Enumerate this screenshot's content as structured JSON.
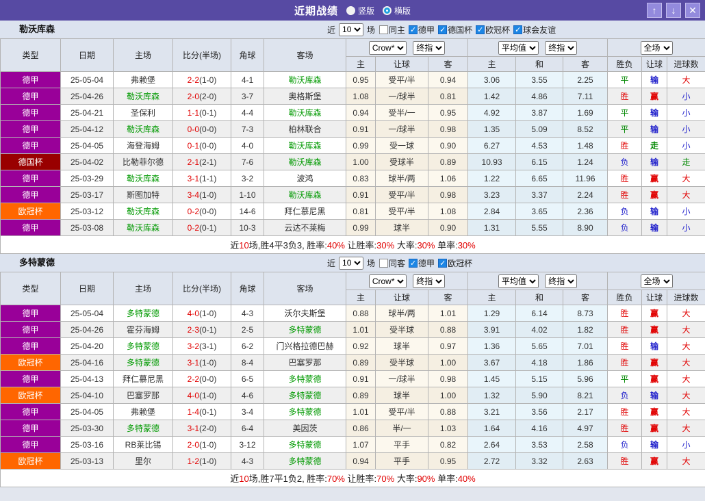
{
  "header": {
    "title": "近期战绩",
    "view_options": [
      {
        "label": "竖版",
        "selected": false
      },
      {
        "label": "横版",
        "selected": true
      }
    ],
    "buttons": {
      "up": "↑",
      "down": "↓",
      "close": "✕"
    }
  },
  "filters_labels": {
    "near": "近",
    "games": "场"
  },
  "selects": {
    "book": "Crow*",
    "final": "终指",
    "avg": "平均值",
    "scope": "全场"
  },
  "columns": {
    "type": "类型",
    "date": "日期",
    "home": "主场",
    "score": "比分(半场)",
    "corner": "角球",
    "away": "客场",
    "sub_home": "主",
    "sub_handicap": "让球",
    "sub_away": "客",
    "sub_avg_home": "主",
    "sub_avg_draw": "和",
    "sub_avg_away": "客",
    "sub_wdl": "胜负",
    "sub_handicap_result": "让球",
    "sub_goals": "进球数"
  },
  "colors": {
    "titlebar": "#574aa3",
    "badge": {
      "德甲": "#990099",
      "德国杯": "#990000",
      "欧冠杯": "#ff6600"
    },
    "result": {
      "胜": "#e10000",
      "平": "#008800",
      "负": "#2222cc",
      "赢": "#e10000",
      "输": "#2222cc",
      "走": "#008800",
      "大": "#e10000",
      "小": "#2222cc"
    },
    "focal_team": "#009900"
  },
  "tables": [
    {
      "team": "勒沃库森",
      "filters": {
        "count": "10",
        "checkboxes": [
          {
            "label": "同主",
            "checked": false
          },
          {
            "label": "德甲",
            "checked": true
          },
          {
            "label": "德国杯",
            "checked": true
          },
          {
            "label": "欧冠杯",
            "checked": true
          },
          {
            "label": "球会友谊",
            "checked": true
          }
        ]
      },
      "rows": [
        {
          "type": "德甲",
          "date": "25-05-04",
          "home": "弗赖堡",
          "score": "2-2",
          "half": "(1-0)",
          "corner": "4-1",
          "away": "勒沃库森",
          "crow": [
            "0.95",
            "受平/半",
            "0.94"
          ],
          "avg": [
            "3.06",
            "3.55",
            "2.25"
          ],
          "result": [
            "平",
            "输",
            "大"
          ]
        },
        {
          "type": "德甲",
          "date": "25-04-26",
          "home": "勒沃库森",
          "score": "2-0",
          "half": "(2-0)",
          "corner": "3-7",
          "away": "奥格斯堡",
          "crow": [
            "1.08",
            "一/球半",
            "0.81"
          ],
          "avg": [
            "1.42",
            "4.86",
            "7.11"
          ],
          "result": [
            "胜",
            "赢",
            "小"
          ]
        },
        {
          "type": "德甲",
          "date": "25-04-21",
          "home": "圣保利",
          "score": "1-1",
          "half": "(0-1)",
          "corner": "4-4",
          "away": "勒沃库森",
          "crow": [
            "0.94",
            "受半/一",
            "0.95"
          ],
          "avg": [
            "4.92",
            "3.87",
            "1.69"
          ],
          "result": [
            "平",
            "输",
            "小"
          ]
        },
        {
          "type": "德甲",
          "date": "25-04-12",
          "home": "勒沃库森",
          "score": "0-0",
          "half": "(0-0)",
          "corner": "7-3",
          "away": "柏林联合",
          "crow": [
            "0.91",
            "一/球半",
            "0.98"
          ],
          "avg": [
            "1.35",
            "5.09",
            "8.52"
          ],
          "result": [
            "平",
            "输",
            "小"
          ]
        },
        {
          "type": "德甲",
          "date": "25-04-05",
          "home": "海登海姆",
          "score": "0-1",
          "half": "(0-0)",
          "corner": "4-0",
          "away": "勒沃库森",
          "crow": [
            "0.99",
            "受一球",
            "0.90"
          ],
          "avg": [
            "6.27",
            "4.53",
            "1.48"
          ],
          "result": [
            "胜",
            "走",
            "小"
          ]
        },
        {
          "type": "德国杯",
          "date": "25-04-02",
          "home": "比勒菲尔德",
          "score": "2-1",
          "half": "(2-1)",
          "corner": "7-6",
          "away": "勒沃库森",
          "crow": [
            "1.00",
            "受球半",
            "0.89"
          ],
          "avg": [
            "10.93",
            "6.15",
            "1.24"
          ],
          "result": [
            "负",
            "输",
            "走"
          ]
        },
        {
          "type": "德甲",
          "date": "25-03-29",
          "home": "勒沃库森",
          "score": "3-1",
          "half": "(1-1)",
          "corner": "3-2",
          "away": "波鸿",
          "crow": [
            "0.83",
            "球半/两",
            "1.06"
          ],
          "avg": [
            "1.22",
            "6.65",
            "11.96"
          ],
          "result": [
            "胜",
            "赢",
            "大"
          ]
        },
        {
          "type": "德甲",
          "date": "25-03-17",
          "home": "斯图加特",
          "score": "3-4",
          "half": "(1-0)",
          "corner": "1-10",
          "away": "勒沃库森",
          "crow": [
            "0.91",
            "受平/半",
            "0.98"
          ],
          "avg": [
            "3.23",
            "3.37",
            "2.24"
          ],
          "result": [
            "胜",
            "赢",
            "大"
          ]
        },
        {
          "type": "欧冠杯",
          "date": "25-03-12",
          "home": "勒沃库森",
          "score": "0-2",
          "half": "(0-0)",
          "corner": "14-6",
          "away": "拜仁慕尼黑",
          "crow": [
            "0.81",
            "受平/半",
            "1.08"
          ],
          "avg": [
            "2.84",
            "3.65",
            "2.36"
          ],
          "result": [
            "负",
            "输",
            "小"
          ]
        },
        {
          "type": "德甲",
          "date": "25-03-08",
          "home": "勒沃库森",
          "score": "0-2",
          "half": "(0-1)",
          "corner": "10-3",
          "away": "云达不莱梅",
          "crow": [
            "0.99",
            "球半",
            "0.90"
          ],
          "avg": [
            "1.31",
            "5.55",
            "8.90"
          ],
          "result": [
            "负",
            "输",
            "小"
          ]
        }
      ],
      "summary": [
        {
          "text": "近",
          "red": false
        },
        {
          "text": "10",
          "red": true
        },
        {
          "text": "场,胜4平3负3, 胜率:",
          "red": false
        },
        {
          "text": "40%",
          "red": true
        },
        {
          "text": " 让胜率:",
          "red": false
        },
        {
          "text": "30%",
          "red": true
        },
        {
          "text": " 大率:",
          "red": false
        },
        {
          "text": "30%",
          "red": true
        },
        {
          "text": " 单率:",
          "red": false
        },
        {
          "text": "30%",
          "red": true
        }
      ]
    },
    {
      "team": "多特蒙德",
      "filters": {
        "count": "10",
        "checkboxes": [
          {
            "label": "同客",
            "checked": false
          },
          {
            "label": "德甲",
            "checked": true
          },
          {
            "label": "欧冠杯",
            "checked": true
          }
        ]
      },
      "rows": [
        {
          "type": "德甲",
          "date": "25-05-04",
          "home": "多特蒙德",
          "score": "4-0",
          "half": "(1-0)",
          "corner": "4-3",
          "away": "沃尔夫斯堡",
          "crow": [
            "0.88",
            "球半/两",
            "1.01"
          ],
          "avg": [
            "1.29",
            "6.14",
            "8.73"
          ],
          "result": [
            "胜",
            "赢",
            "大"
          ]
        },
        {
          "type": "德甲",
          "date": "25-04-26",
          "home": "霍芬海姆",
          "score": "2-3",
          "half": "(0-1)",
          "corner": "2-5",
          "away": "多特蒙德",
          "crow": [
            "1.01",
            "受半球",
            "0.88"
          ],
          "avg": [
            "3.91",
            "4.02",
            "1.82"
          ],
          "result": [
            "胜",
            "赢",
            "大"
          ]
        },
        {
          "type": "德甲",
          "date": "25-04-20",
          "home": "多特蒙德",
          "score": "3-2",
          "half": "(3-1)",
          "corner": "6-2",
          "away": "门兴格拉德巴赫",
          "crow": [
            "0.92",
            "球半",
            "0.97"
          ],
          "avg": [
            "1.36",
            "5.65",
            "7.01"
          ],
          "result": [
            "胜",
            "输",
            "大"
          ]
        },
        {
          "type": "欧冠杯",
          "date": "25-04-16",
          "home": "多特蒙德",
          "score": "3-1",
          "half": "(1-0)",
          "corner": "8-4",
          "away": "巴塞罗那",
          "crow": [
            "0.89",
            "受半球",
            "1.00"
          ],
          "avg": [
            "3.67",
            "4.18",
            "1.86"
          ],
          "result": [
            "胜",
            "赢",
            "大"
          ]
        },
        {
          "type": "德甲",
          "date": "25-04-13",
          "home": "拜仁慕尼黑",
          "score": "2-2",
          "half": "(0-0)",
          "corner": "6-5",
          "away": "多特蒙德",
          "crow": [
            "0.91",
            "一/球半",
            "0.98"
          ],
          "avg": [
            "1.45",
            "5.15",
            "5.96"
          ],
          "result": [
            "平",
            "赢",
            "大"
          ]
        },
        {
          "type": "欧冠杯",
          "date": "25-04-10",
          "home": "巴塞罗那",
          "score": "4-0",
          "half": "(1-0)",
          "corner": "4-6",
          "away": "多特蒙德",
          "crow": [
            "0.89",
            "球半",
            "1.00"
          ],
          "avg": [
            "1.32",
            "5.90",
            "8.21"
          ],
          "result": [
            "负",
            "输",
            "大"
          ]
        },
        {
          "type": "德甲",
          "date": "25-04-05",
          "home": "弗赖堡",
          "score": "1-4",
          "half": "(0-1)",
          "corner": "3-4",
          "away": "多特蒙德",
          "crow": [
            "1.01",
            "受平/半",
            "0.88"
          ],
          "avg": [
            "3.21",
            "3.56",
            "2.17"
          ],
          "result": [
            "胜",
            "赢",
            "大"
          ]
        },
        {
          "type": "德甲",
          "date": "25-03-30",
          "home": "多特蒙德",
          "score": "3-1",
          "half": "(2-0)",
          "corner": "6-4",
          "away": "美因茨",
          "crow": [
            "0.86",
            "半/一",
            "1.03"
          ],
          "avg": [
            "1.64",
            "4.16",
            "4.97"
          ],
          "result": [
            "胜",
            "赢",
            "大"
          ]
        },
        {
          "type": "德甲",
          "date": "25-03-16",
          "home": "RB莱比锡",
          "score": "2-0",
          "half": "(1-0)",
          "corner": "3-12",
          "away": "多特蒙德",
          "crow": [
            "1.07",
            "平手",
            "0.82"
          ],
          "avg": [
            "2.64",
            "3.53",
            "2.58"
          ],
          "result": [
            "负",
            "输",
            "小"
          ]
        },
        {
          "type": "欧冠杯",
          "date": "25-03-13",
          "home": "里尔",
          "score": "1-2",
          "half": "(1-0)",
          "corner": "4-3",
          "away": "多特蒙德",
          "crow": [
            "0.94",
            "平手",
            "0.95"
          ],
          "avg": [
            "2.72",
            "3.32",
            "2.63"
          ],
          "result": [
            "胜",
            "赢",
            "大"
          ]
        }
      ],
      "summary": [
        {
          "text": "近",
          "red": false
        },
        {
          "text": "10",
          "red": true
        },
        {
          "text": "场,胜7平1负2, 胜率:",
          "red": false
        },
        {
          "text": "70%",
          "red": true
        },
        {
          "text": " 让胜率:",
          "red": false
        },
        {
          "text": "70%",
          "red": true
        },
        {
          "text": " 大率:",
          "red": false
        },
        {
          "text": "90%",
          "red": true
        },
        {
          "text": " 单率:",
          "red": false
        },
        {
          "text": "40%",
          "red": true
        }
      ]
    }
  ]
}
